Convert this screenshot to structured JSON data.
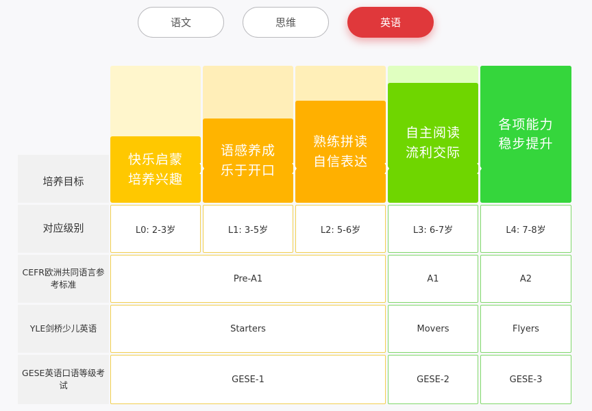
{
  "tabs": [
    {
      "label": "语文",
      "active": false
    },
    {
      "label": "思维",
      "active": false
    },
    {
      "label": "英语",
      "active": true
    }
  ],
  "row_labels": {
    "goal": "培养目标",
    "level": "对应级别",
    "cefr": "CEFR欧洲共同语言参考标准",
    "yle": "YLE剑桥少儿英语",
    "gese": "GESE英语口语等级考试"
  },
  "stages": [
    {
      "line1": "快乐启蒙",
      "line2": "培养兴趣",
      "level": "L0: 2-3岁",
      "color": "#ffc800",
      "bg_color": "#fff6cc"
    },
    {
      "line1": "语感养成",
      "line2": "乐于开口",
      "level": "L1: 3-5岁",
      "color": "#ffb400",
      "bg_color": "#ffeeb8"
    },
    {
      "line1": "熟练拼读",
      "line2": "自信表达",
      "level": "L2: 5-6岁",
      "color": "#ffb000",
      "bg_color": "#ffefb8"
    },
    {
      "line1": "自主阅读",
      "line2": "流利交际",
      "level": "L3: 6-7岁",
      "color": "#6fd600",
      "bg_color": "#e0ffc0"
    },
    {
      "line1": "各项能力",
      "line2": "稳步提升",
      "level": "L4: 7-8岁",
      "color": "#35d63c",
      "bg_color": "#35d63c"
    }
  ],
  "cefr": [
    "Pre-A1",
    "A1",
    "A2"
  ],
  "yle": [
    "Starters",
    "Movers",
    "Flyers"
  ],
  "gese": [
    "GESE-1",
    "GESE-2",
    "GESE-3"
  ]
}
